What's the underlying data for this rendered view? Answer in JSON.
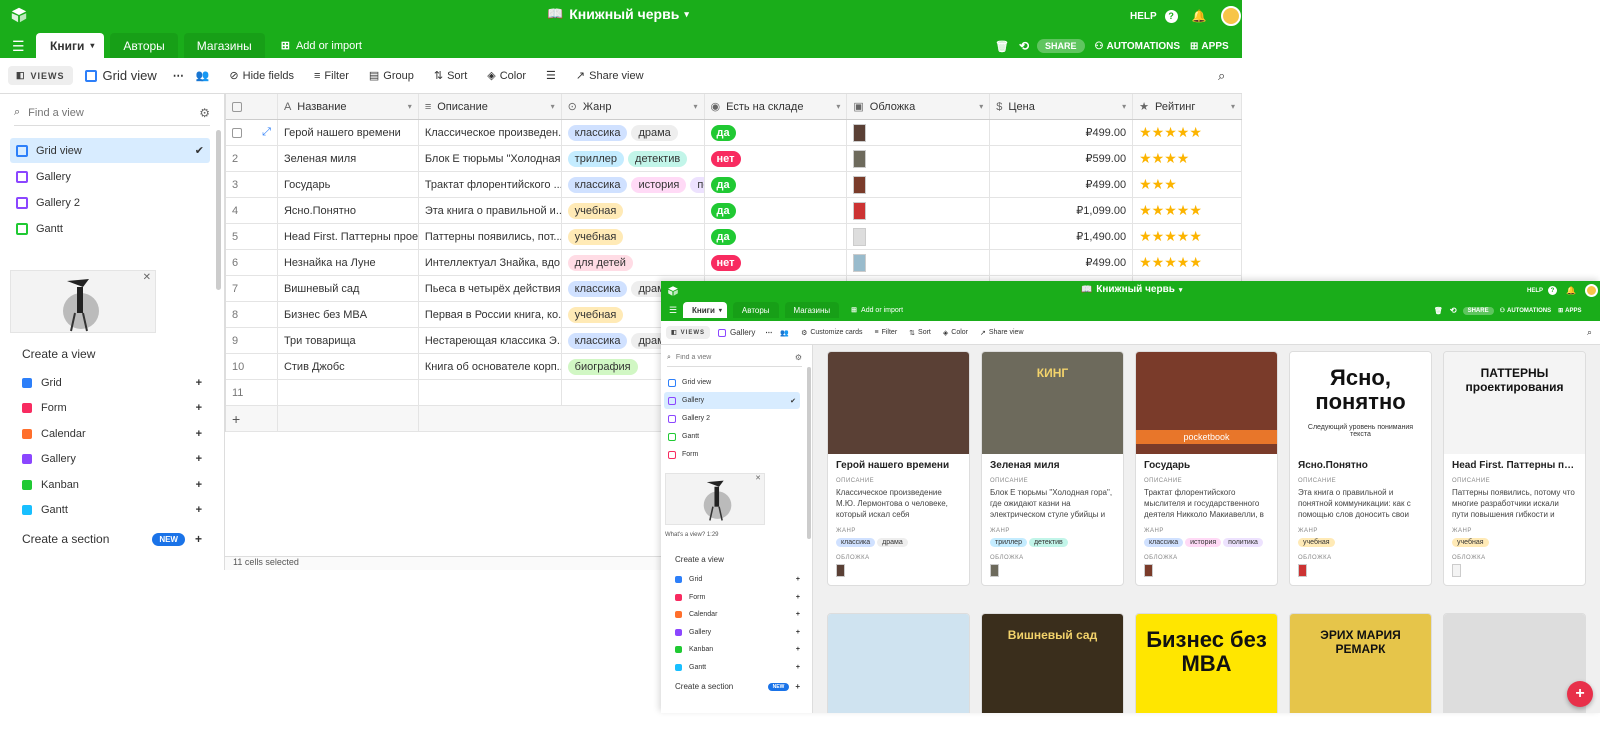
{
  "app": {
    "base_title": "Книжный червь",
    "help_label": "HELP"
  },
  "tabs": [
    {
      "label": "Книги"
    },
    {
      "label": "Авторы"
    },
    {
      "label": "Магазины"
    }
  ],
  "add_or_import": "Add or import",
  "actions": {
    "share": "SHARE",
    "automations": "AUTOMATIONS",
    "apps": "APPS"
  },
  "toolbar": {
    "views": "VIEWS",
    "current_view": "Grid view",
    "hide_fields": "Hide fields",
    "filter": "Filter",
    "group": "Group",
    "sort": "Sort",
    "color": "Color",
    "share_view": "Share view"
  },
  "sidebar": {
    "find_placeholder": "Find a view",
    "views": [
      {
        "label": "Grid view",
        "icon": "grid-icon",
        "color": "#2d7ff9"
      },
      {
        "label": "Gallery",
        "icon": "gallery-icon",
        "color": "#8b46ff"
      },
      {
        "label": "Gallery 2",
        "icon": "gallery-icon",
        "color": "#8b46ff"
      },
      {
        "label": "Gantt",
        "icon": "gantt-icon",
        "color": "#20c933"
      }
    ],
    "create_view": "Create a view",
    "create_items": [
      {
        "label": "Grid",
        "color": "#2d7ff9"
      },
      {
        "label": "Form",
        "color": "#f82b60"
      },
      {
        "label": "Calendar",
        "color": "#ff6f2c"
      },
      {
        "label": "Gallery",
        "color": "#8b46ff"
      },
      {
        "label": "Kanban",
        "color": "#20c933"
      },
      {
        "label": "Gantt",
        "color": "#18bfff"
      }
    ],
    "create_section": "Create a section",
    "new_badge": "NEW"
  },
  "grid": {
    "columns": [
      "Название",
      "Описание",
      "Жанр",
      "Есть на складе",
      "Обложка",
      "Цена",
      "Рейтинг"
    ],
    "rows": [
      {
        "num": "1",
        "name": "Герой нашего времени",
        "desc": "Классическое произведен...",
        "genres": [
          "классика",
          "драма"
        ],
        "stock": "да",
        "price": "₽499.00",
        "rating": 5
      },
      {
        "num": "2",
        "name": "Зеленая миля",
        "desc": "Блок Е тюрьмы \"Холодная...",
        "genres": [
          "триллер",
          "детектив"
        ],
        "stock": "нет",
        "price": "₽599.00",
        "rating": 4
      },
      {
        "num": "3",
        "name": "Государь",
        "desc": "Трактат флорентийского ...",
        "genres": [
          "классика",
          "история",
          "поли"
        ],
        "stock": "да",
        "price": "₽499.00",
        "rating": 3
      },
      {
        "num": "4",
        "name": "Ясно.Понятно",
        "desc": "Эта книга о правильной и...",
        "genres": [
          "учебная"
        ],
        "stock": "да",
        "price": "₽1,099.00",
        "rating": 5
      },
      {
        "num": "5",
        "name": "Head First. Паттерны прое...",
        "desc": "Паттерны появились, пот...",
        "genres": [
          "учебная"
        ],
        "stock": "да",
        "price": "₽1,490.00",
        "rating": 5
      },
      {
        "num": "6",
        "name": "Незнайка на Луне",
        "desc": "Интеллектуал Знайка, вдо...",
        "genres": [
          "для детей"
        ],
        "stock": "нет",
        "price": "₽499.00",
        "rating": 5
      },
      {
        "num": "7",
        "name": "Вишневый сад",
        "desc": "Пьеса в четырёх действия...",
        "genres": [
          "классика",
          "драм"
        ],
        "stock": "",
        "price": "",
        "rating": 0
      },
      {
        "num": "8",
        "name": "Бизнес без MBA",
        "desc": "Первая в России книга, ко...",
        "genres": [
          "учебная"
        ],
        "stock": "",
        "price": "",
        "rating": 0
      },
      {
        "num": "9",
        "name": "Три товарища",
        "desc": "Нестареющая классика Э...",
        "genres": [
          "классика",
          "драм"
        ],
        "stock": "",
        "price": "",
        "rating": 0
      },
      {
        "num": "10",
        "name": "Стив Джобс",
        "desc": "Книга об основателе корп...",
        "genres": [
          "биография"
        ],
        "stock": "",
        "price": "",
        "rating": 0
      },
      {
        "num": "11",
        "name": "",
        "desc": "",
        "genres": [],
        "stock": "",
        "price": "",
        "rating": 0
      }
    ],
    "footer": "11 cells selected"
  },
  "genre_colors": {
    "классика": "#d0e1ff",
    "драма": "#eeeeee",
    "драм": "#eeeeee",
    "триллер": "#c4ecff",
    "детектив": "#c2f5e9",
    "история": "#ffdaf6",
    "поли": "#ede2fe",
    "политика": "#ede2fe",
    "учебная": "#ffeab6",
    "для детей": "#ffdce5",
    "биография": "#d1f7c4"
  },
  "stock_colors": {
    "да": "#20c933",
    "нет": "#f82b60"
  },
  "gallery_window": {
    "current_view": "Gallery",
    "customize_cards": "Customize cards",
    "filter": "Filter",
    "sort": "Sort",
    "color": "Color",
    "share_view": "Share view",
    "views": [
      {
        "label": "Grid view",
        "color": "#2d7ff9"
      },
      {
        "label": "Gallery",
        "color": "#8b46ff"
      },
      {
        "label": "Gallery 2",
        "color": "#8b46ff"
      },
      {
        "label": "Gantt",
        "color": "#20c933"
      },
      {
        "label": "Form",
        "color": "#f82b60"
      }
    ],
    "whats_view": "What's a view? 1:29",
    "label_description": "ОПИСАНИЕ",
    "label_genre": "ЖАНР",
    "label_cover": "ОБЛОЖКА",
    "cards": [
      {
        "title": "Герой нашего времени",
        "desc": "Классическое произведение М.Ю. Лермонтова о человеке, который искал себя",
        "genres": [
          "классика",
          "драма"
        ],
        "cover": "#5a4035"
      },
      {
        "title": "Зеленая миля",
        "desc": "Блок Е тюрьмы \"Холодная гора\", где ожидают казни на электрическом стуле убийцы и насильники. Все как один они пройдут Зеленую милю ...",
        "genres": [
          "триллер",
          "детектив"
        ],
        "cover": "#6d6a5c",
        "cover_text": "КИНГ"
      },
      {
        "title": "Государь",
        "desc": "Трактат флорентийского мыслителя и государственного деятеля Никколо Макиавелли, в котором описываются методология захвата ...",
        "genres": [
          "классика",
          "история",
          "политика"
        ],
        "cover": "#7a3b2a",
        "cover_text": "pocketbook"
      },
      {
        "title": "Ясно.Понятно",
        "desc": "Эта книга о правильной и понятной коммуникации: как с помощью слов доносить свои мысли и объяснять людям. Максим Ильяхов развивает...",
        "genres": [
          "учебная"
        ],
        "cover": "#ffffff",
        "cover_text": "Ясно, понятно",
        "cover_sub": "Следующий уровень понимания текста"
      },
      {
        "title": "Head First. Паттерны проек...",
        "desc": "Паттерны появились, потому что многие разработчики искали пути повышения гибкости и степени повторного использования своих ...",
        "genres": [
          "учебная"
        ],
        "cover": "#f4f4f4",
        "cover_text": "ПАТТЕРНЫ проектирования"
      },
      {
        "cover": "#cfe3f0"
      },
      {
        "cover": "#3a2e1c",
        "cover_text": "Вишневый сад"
      },
      {
        "cover": "#ffe600",
        "cover_text": "Бизнес без MBA"
      },
      {
        "cover": "#e6c54a",
        "cover_text": "ЭРИХ МАРИЯ РЕМАРК"
      },
      {
        "cover": "#dddddd"
      }
    ]
  }
}
